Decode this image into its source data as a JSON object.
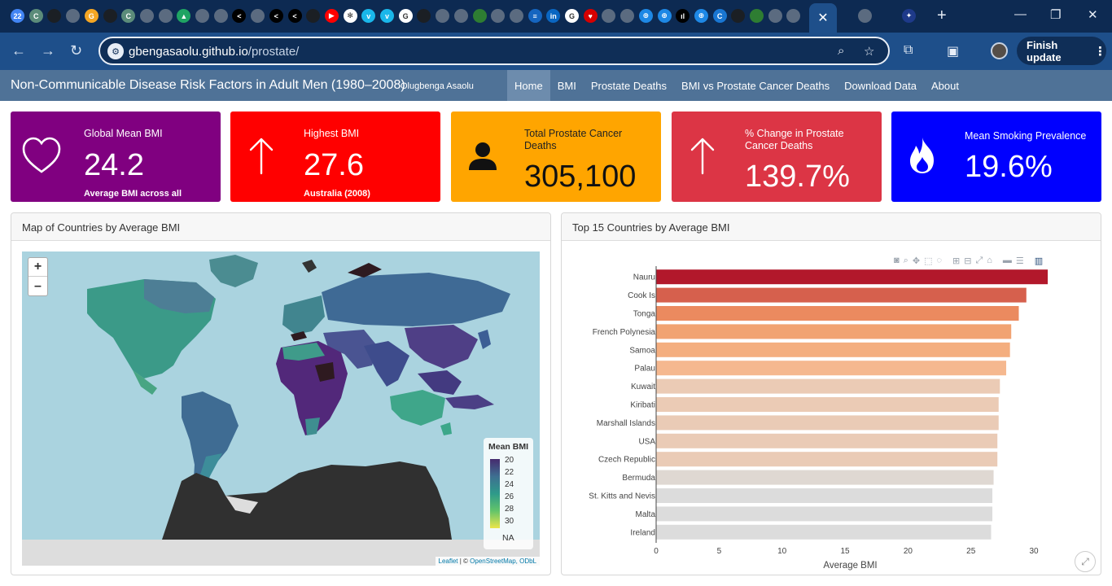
{
  "browser": {
    "url_host": "gbengasaolu.github.io",
    "url_path": "/prostate/",
    "finish_update_label": "Finish update",
    "tab_icons": [
      {
        "name": "calendar-tab-icon",
        "bg": "#4285f4",
        "label": "22"
      },
      {
        "name": "casm-tab-icon",
        "bg": "#5b8c7a",
        "label": "C"
      },
      {
        "name": "github-tab-icon",
        "bg": "#1b1f24",
        "label": ""
      },
      {
        "name": "globe-tab-icon",
        "bg": "#5b6b80",
        "label": ""
      },
      {
        "name": "orange-tab-icon",
        "bg": "#f5a623",
        "label": "G"
      },
      {
        "name": "github-tab-icon",
        "bg": "#1b1f24",
        "label": ""
      },
      {
        "name": "casm-tab-icon",
        "bg": "#5b8c7a",
        "label": "C"
      },
      {
        "name": "globe-tab-icon",
        "bg": "#5b6b80",
        "label": ""
      },
      {
        "name": "globe-tab-icon",
        "bg": "#5b6b80",
        "label": ""
      },
      {
        "name": "drive-tab-icon",
        "bg": "#1fa463",
        "label": "▲"
      },
      {
        "name": "globe-tab-icon",
        "bg": "#5b6b80",
        "label": ""
      },
      {
        "name": "globe-tab-icon",
        "bg": "#5b6b80",
        "label": ""
      },
      {
        "name": "share-tab-icon",
        "bg": "#000000",
        "label": "<"
      },
      {
        "name": "globe-tab-icon",
        "bg": "#5b6b80",
        "label": ""
      },
      {
        "name": "share-tab-icon",
        "bg": "#000000",
        "label": "<"
      },
      {
        "name": "share-tab-icon",
        "bg": "#000000",
        "label": "<"
      },
      {
        "name": "github-tab-icon",
        "bg": "#1b1f24",
        "label": ""
      },
      {
        "name": "youtube-tab-icon",
        "bg": "#ff0000",
        "label": "▶"
      },
      {
        "name": "chatgpt-tab-icon",
        "bg": "#ffffff",
        "label": "✻"
      },
      {
        "name": "vimeo-tab-icon",
        "bg": "#1ab7ea",
        "label": "v"
      },
      {
        "name": "vimeo-tab-icon",
        "bg": "#1ab7ea",
        "label": "v"
      },
      {
        "name": "google-tab-icon",
        "bg": "#ffffff",
        "label": "G"
      },
      {
        "name": "github-tab-icon",
        "bg": "#1b1f24",
        "label": ""
      },
      {
        "name": "globe-tab-icon",
        "bg": "#5b6b80",
        "label": ""
      },
      {
        "name": "globe-tab-icon",
        "bg": "#5b6b80",
        "label": ""
      },
      {
        "name": "shield-tab-icon",
        "bg": "#2e7d32",
        "label": ""
      },
      {
        "name": "globe-tab-icon",
        "bg": "#5b6b80",
        "label": ""
      },
      {
        "name": "globe-tab-icon",
        "bg": "#5b6b80",
        "label": ""
      },
      {
        "name": "news-tab-icon",
        "bg": "#1565c0",
        "label": "≡"
      },
      {
        "name": "linkedin-tab-icon",
        "bg": "#0a66c2",
        "label": "in"
      },
      {
        "name": "google-tab-icon",
        "bg": "#ffffff",
        "label": "G"
      },
      {
        "name": "heart-tab-icon",
        "bg": "#d50000",
        "label": "♥"
      },
      {
        "name": "globe-tab-icon",
        "bg": "#5b6b80",
        "label": ""
      },
      {
        "name": "globe-tab-icon",
        "bg": "#5b6b80",
        "label": ""
      },
      {
        "name": "grid-globe-tab-icon",
        "bg": "#1e88e5",
        "label": "⊕"
      },
      {
        "name": "grid-globe-tab-icon",
        "bg": "#1e88e5",
        "label": "⊕"
      },
      {
        "name": "chart-tab-icon",
        "bg": "#000000",
        "label": "ıl"
      },
      {
        "name": "grid-globe-tab-icon",
        "bg": "#1e88e5",
        "label": "⊕"
      },
      {
        "name": "c-tab-icon",
        "bg": "#1976d2",
        "label": "C"
      },
      {
        "name": "github-tab-icon",
        "bg": "#1b1f24",
        "label": ""
      },
      {
        "name": "shield-tab-icon",
        "bg": "#2e7d32",
        "label": ""
      },
      {
        "name": "globe-tab-icon",
        "bg": "#5b6b80",
        "label": ""
      },
      {
        "name": "globe-tab-icon",
        "bg": "#5b6b80",
        "label": ""
      },
      {
        "name": "globe-tab-icon",
        "bg": "#5b6b80",
        "label": ""
      },
      {
        "name": "sparkle-tab-icon",
        "bg": "#1e3a8a",
        "label": "✦"
      }
    ]
  },
  "app": {
    "title": "Non-Communicable Disease Risk Factors in Adult Men (1980–2008)",
    "author": "Olugbenga Asaolu",
    "nav": [
      "Home",
      "BMI",
      "Prostate Deaths",
      "BMI vs Prostate Cancer Deaths",
      "Download Data",
      "About"
    ],
    "active_nav": "Home"
  },
  "value_boxes": [
    {
      "title": "Global Mean BMI",
      "value": "24.2",
      "subtitle": "Average BMI across all",
      "color": "#800080",
      "icon": "heart-icon"
    },
    {
      "title": "Highest BMI",
      "value": "27.6",
      "subtitle": "Australia (2008)",
      "color": "#ff0000",
      "icon": "arrow-up-icon"
    },
    {
      "title": "Total Prostate Cancer Deaths",
      "value": "305,100",
      "subtitle": "",
      "color": "#ffa500",
      "icon": "person-icon"
    },
    {
      "title": "% Change in Prostate Cancer Deaths",
      "value": "139.7%",
      "subtitle": "",
      "color": "#dc3545",
      "icon": "arrow-up-icon"
    },
    {
      "title": "Mean Smoking Prevalence",
      "value": "19.6%",
      "subtitle": "",
      "color": "#0000ff",
      "icon": "fire-icon"
    }
  ],
  "map_card": {
    "title": "Map of Countries by Average BMI",
    "zoom_in": "+",
    "zoom_out": "–",
    "legend_title": "Mean BMI",
    "legend_ticks": [
      "20",
      "22",
      "24",
      "26",
      "28",
      "30"
    ],
    "legend_na": "NA",
    "attribution_leaflet": "Leaflet",
    "attribution_sep": " | © ",
    "attribution_osm": "OpenStreetMap, ODbL"
  },
  "bar_card": {
    "title": "Top 15 Countries by Average BMI"
  },
  "chart_data": {
    "type": "bar",
    "orientation": "horizontal",
    "title": "",
    "xlabel": "Average BMI",
    "ylabel": "",
    "xlim": [
      0,
      32
    ],
    "xticks": [
      0,
      5,
      10,
      15,
      20,
      25,
      30
    ],
    "grid": false,
    "categories": [
      "Nauru",
      "Cook Is",
      "Tonga",
      "French Polynesia",
      "Samoa",
      "Palau",
      "Kuwait",
      "Kiribati",
      "Marshall Islands",
      "USA",
      "Czech Republic",
      "Bermuda",
      "St. Kitts and Nevis",
      "Malta",
      "Ireland"
    ],
    "values": [
      31.1,
      29.4,
      28.8,
      28.2,
      28.1,
      27.8,
      27.3,
      27.2,
      27.2,
      27.1,
      27.1,
      26.8,
      26.7,
      26.7,
      26.6
    ],
    "colors": [
      "#b2182b",
      "#d6604d",
      "#eb8a5f",
      "#f1a372",
      "#f4ae7f",
      "#f5b88f",
      "#ebcbb5",
      "#ebcbb5",
      "#eacbb6",
      "#eacbb6",
      "#eacbb6",
      "#dfd8d2",
      "#dcdcdc",
      "#dcdcdc",
      "#dcdcdc"
    ]
  }
}
